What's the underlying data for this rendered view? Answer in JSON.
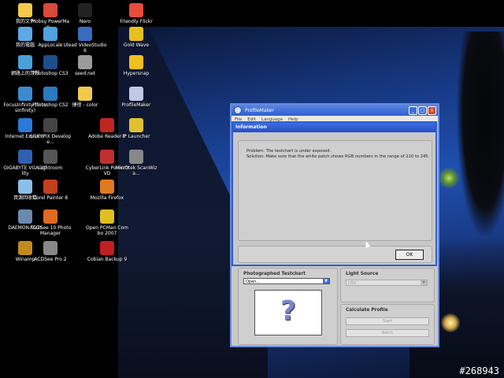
{
  "watermark": "#268943",
  "desktop_icons": [
    {
      "label": "我的文件",
      "icon": "folder-documents-icon",
      "color": "#f2c94c"
    },
    {
      "label": "Mobsy PowerMap...",
      "icon": "mobsy-icon",
      "color": "#d84a3a"
    },
    {
      "label": "Nero",
      "icon": "nero-icon",
      "color": "#222222"
    },
    {
      "label": "Friendly Flickr",
      "icon": "flickr-icon",
      "color": "#e74c3c"
    },
    {
      "label": "我的電腦",
      "icon": "my-computer-icon",
      "color": "#5fa8e8"
    },
    {
      "label": "AppLocale",
      "icon": "applocale-icon",
      "color": "#4ea3e0"
    },
    {
      "label": "Ulead VideoStudio 6",
      "icon": "ulead-icon",
      "color": "#3a6cc0"
    },
    {
      "label": "Gold Wave",
      "icon": "goldwave-icon",
      "color": "#e6c020"
    },
    {
      "label": "網路上的芳鄰",
      "icon": "network-icon",
      "color": "#4aa0d8"
    },
    {
      "label": "Photoshop CS3",
      "icon": "photoshop-cs3-icon",
      "color": "#1d4f8a"
    },
    {
      "label": "seed.net",
      "icon": "seednet-icon",
      "color": "#9a9a9a"
    },
    {
      "label": "Hypersnap",
      "icon": "hypersnap-icon",
      "color": "#f0c020"
    },
    {
      "label": "FocusInfinity (focusinfinity)",
      "icon": "focusinfinity-icon",
      "color": "#3a8ad0"
    },
    {
      "label": "Photoshop CS2",
      "icon": "photoshop-cs2-icon",
      "color": "#2a7ac0"
    },
    {
      "label": "捷徑 - color",
      "icon": "folder-color-icon",
      "color": "#f2c94c"
    },
    {
      "label": "ProfileMaker",
      "icon": "profilemaker-icon",
      "color": "#c0c8e8"
    },
    {
      "label": "Internet Explorer",
      "icon": "ie-icon",
      "color": "#2a7ad8"
    },
    {
      "label": "SILKYPIX Develope...",
      "icon": "silkypix-icon",
      "color": "#444444"
    },
    {
      "label": "Adobe Reader 8",
      "icon": "adobe-reader-icon",
      "color": "#c0261f"
    },
    {
      "label": "IP Launcher",
      "icon": "ip-launcher-icon",
      "color": "#e0c030"
    },
    {
      "label": "GIGABYTE VGA Utility",
      "icon": "gigabyte-icon",
      "color": "#3060b0"
    },
    {
      "label": "Lightroom",
      "icon": "lightroom-icon",
      "color": "#555555"
    },
    {
      "label": "CyberLink PowerDVD",
      "icon": "powerdvd-icon",
      "color": "#c03030"
    },
    {
      "label": "Microtek ScanWiza...",
      "icon": "scanwizard-icon",
      "color": "#888888"
    },
    {
      "label": "資源回收筒",
      "icon": "recycle-bin-icon",
      "color": "#8ac0e8"
    },
    {
      "label": "Corel Painter 8",
      "icon": "corel-painter-icon",
      "color": "#c04020"
    },
    {
      "label": "Mozilla Firefox",
      "icon": "firefox-icon",
      "color": "#e07a20"
    },
    {
      "label": "DAEMON Tools",
      "icon": "daemon-tools-icon",
      "color": "#6a8ab0"
    },
    {
      "label": "ACDSee 10 Photo Manager",
      "icon": "acdsee10-icon",
      "color": "#e06a20"
    },
    {
      "label": "Open PCMan Combo 2007",
      "icon": "pcman-icon",
      "color": "#e0c020"
    },
    {
      "label": "Winamp",
      "icon": "winamp-icon",
      "color": "#c08a20"
    },
    {
      "label": "ACDSee Pro 2",
      "icon": "acdsee-pro-icon",
      "color": "#888888"
    },
    {
      "label": "Cobian Backup 9",
      "icon": "cobian-backup-icon",
      "color": "#c02020"
    }
  ],
  "window": {
    "title": "ProfileMaker",
    "menu": [
      "File",
      "Edit",
      "Language",
      "Help"
    ]
  },
  "dialog": {
    "title": "Information",
    "problem": "Problem: The testchart is under exposed.",
    "solution": "Solution: Make sure that the white patch shows RGB numbers in the range of 210 to 245.",
    "ok_label": "OK"
  },
  "testchart": {
    "title": "Photographed Testchart",
    "selected": "Open...",
    "preview_glyph": "?"
  },
  "light_source": {
    "title": "Light Source",
    "selected": "D50"
  },
  "calculate": {
    "title": "Calculate Profile",
    "start_label": "Start",
    "batch_label": "Batch"
  }
}
